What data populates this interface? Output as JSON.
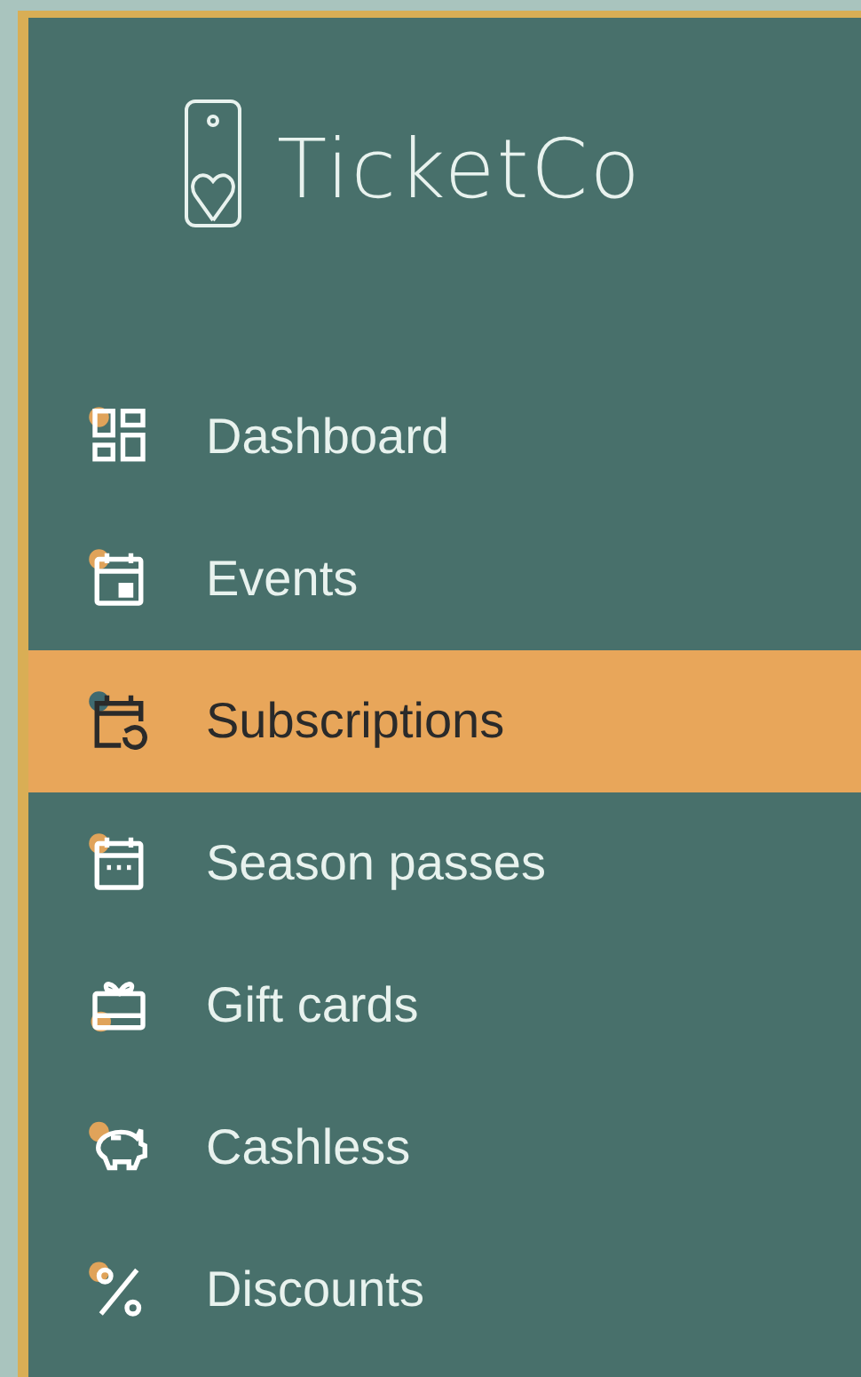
{
  "brand": {
    "name": "TicketCo"
  },
  "nav": [
    {
      "label": "Dashboard",
      "selected": false
    },
    {
      "label": "Events",
      "selected": false
    },
    {
      "label": "Subscriptions",
      "selected": true
    },
    {
      "label": "Season passes",
      "selected": false
    },
    {
      "label": "Gift cards",
      "selected": false
    },
    {
      "label": "Cashless",
      "selected": false
    },
    {
      "label": "Discounts",
      "selected": false
    }
  ]
}
